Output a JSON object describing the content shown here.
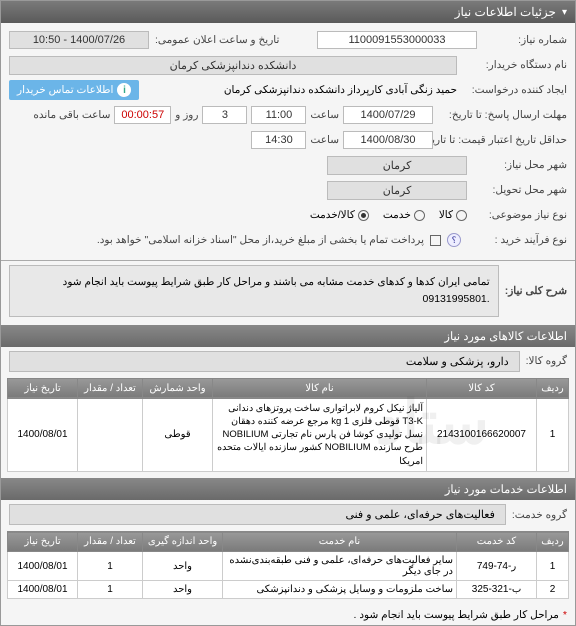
{
  "header": {
    "title": "جزئیات اطلاعات نیاز"
  },
  "form": {
    "need_no_label": "شماره نیاز:",
    "need_no": "1100091553000033",
    "announce_label": "تاریخ و ساعت اعلان عمومی:",
    "announce_value": "1400/07/26 - 10:50",
    "buyer_label": "نام دستگاه خریدار:",
    "buyer_value": "دانشکده دندانپزشکی کرمان",
    "requester_label": "ایجاد کننده درخواست:",
    "requester_value": "حمید زنگی آبادی کارپرداز دانشکده دندانپزشکی کرمان",
    "contact_badge": "اطلاعات تماس خریدار",
    "deadline_label": "مهلت ارسال پاسخ:  تا تاریخ:",
    "deadline_date": "1400/07/29",
    "saat": "ساعت",
    "deadline_time": "11:00",
    "days": "3",
    "days_suffix": "روز و",
    "timer": "00:00:57",
    "remain": "ساعت باقی مانده",
    "validity_label": "حداقل تاریخ اعتبار قیمت: تا تاریخ:",
    "validity_date": "1400/08/30",
    "validity_time": "14:30",
    "need_city_label": "شهر محل نیاز:",
    "need_city": "کرمان",
    "delivery_city_label": "شهر محل تحویل:",
    "delivery_city": "کرمان",
    "subject_type_label": "نوع نیاز موضوعی:",
    "subject_kala": "کالا",
    "subject_khedmat": "خدمت",
    "subject_both": "کالا/خدمت",
    "process_label": "نوع فرآیند خرید :",
    "pay_note": "پرداخت تمام یا بخشی از مبلغ خرید،از محل \"اسناد خزانه اسلامی\" خواهد بود.",
    "info_tip": "؟"
  },
  "desc": {
    "label": "شرح کلی نیاز:",
    "text": "تمامی ایران کدها و کدهای خدمت مشابه می باشند و مراحل کار طبق شرایط پیوست باید انجام شود .09131995801"
  },
  "goods_section": "اطلاعات کالاهای مورد نیاز",
  "goods_group_label": "گروه کالا:",
  "goods_group_value": "دارو، پزشکی و سلامت",
  "goods_table": {
    "headers": [
      "ردیف",
      "کد کالا",
      "نام کالا",
      "واحد شمارش",
      "تعداد / مقدار",
      "تاریخ نیاز"
    ],
    "rows": [
      {
        "idx": "1",
        "code": "2143100166620007",
        "name": "آلیاژ نیکل کروم لابراتواری ساخت پروتزهای دندانی T3-K قوطی فلزی 1 kg مرجع عرضه کننده دهقان نسل تولیدی کوشا فن پارس نام تجارتی NOBILIUM طرح سازنده NOBILIUM کشور سازنده ایالات متحده امریکا",
        "unit": "قوطی",
        "qty": "",
        "date": "1400/08/01"
      }
    ]
  },
  "services_section": "اطلاعات خدمات مورد نیاز",
  "services_group_label": "گروه خدمت:",
  "services_group_value": "فعالیت‌های حرفه‌ای، علمی و فنی",
  "services_table": {
    "headers": [
      "ردیف",
      "کد خدمت",
      "نام خدمت",
      "واحد اندازه گیری",
      "تعداد / مقدار",
      "تاریخ نیاز"
    ],
    "rows": [
      {
        "idx": "1",
        "code": "ر-74-749",
        "name": "سایر فعالیت‌های حرفه‌ای، علمی و فنی طبقه‌بندی‌نشده در جای دیگر",
        "unit": "واحد",
        "qty": "1",
        "date": "1400/08/01"
      },
      {
        "idx": "2",
        "code": "ب-321-325",
        "name": "ساخت ملزومات و وسایل پزشکی و دندانپزشکی",
        "unit": "واحد",
        "qty": "1",
        "date": "1400/08/01"
      }
    ]
  },
  "footer_note": "مراحل کار طبق شرایط پیوست باید انجام شود ."
}
